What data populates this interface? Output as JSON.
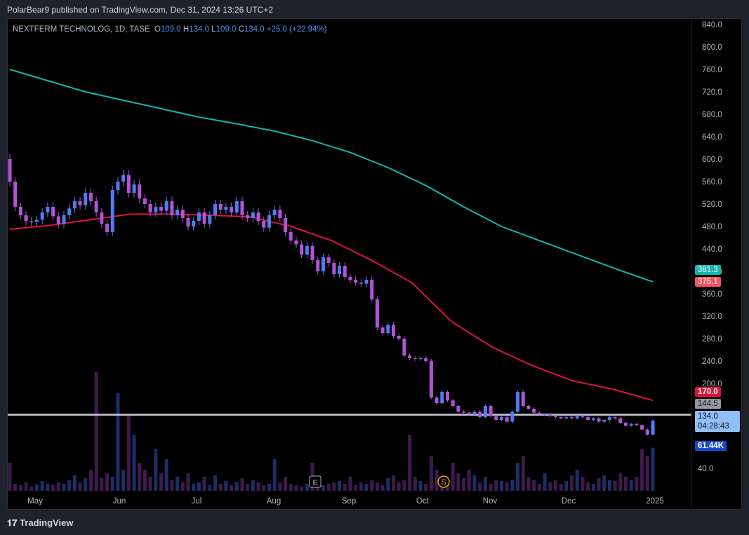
{
  "published": "PolarBear9 published on TradingView.com, Dec 31, 2024 13:26 UTC+2",
  "legend": {
    "symbol": "NEXTFERM TECHNOLOG, 1D, TASE",
    "o_label": "O",
    "o": "109.0",
    "h_label": "H",
    "h": "134.0",
    "l_label": "L",
    "l": "109.0",
    "c_label": "C",
    "c": "134.0",
    "change": "+25.0 (+22.94%)"
  },
  "brand": "TradingView",
  "colors": {
    "up": "#4f7df0",
    "down": "#b452d8",
    "ma_long": "#12b5b0",
    "ma_short": "#e0103a",
    "hline": "#b2b5be"
  },
  "chart_data": {
    "type": "candlestick",
    "x_ticks": [
      "May",
      "Jun",
      "Jul",
      "Aug",
      "Sep",
      "Oct",
      "Nov",
      "Dec",
      "2025"
    ],
    "y_ticks": [
      "840.0",
      "800.0",
      "760.0",
      "720.0",
      "680.0",
      "640.0",
      "600.0",
      "560.0",
      "520.0",
      "480.0",
      "440.0",
      "400.0",
      "360.0",
      "320.0",
      "280.0",
      "240.0",
      "200.0"
    ],
    "ylim": [
      130,
      840
    ],
    "first_open": 600,
    "closes": [
      560,
      515,
      500,
      490,
      488,
      492,
      505,
      515,
      498,
      485,
      500,
      512,
      525,
      518,
      540,
      525,
      505,
      485,
      470,
      545,
      560,
      572,
      540,
      555,
      530,
      520,
      505,
      515,
      508,
      525,
      500,
      510,
      495,
      480,
      490,
      505,
      485,
      500,
      520,
      510,
      515,
      505,
      525,
      500,
      495,
      505,
      490,
      478,
      500,
      510,
      495,
      470,
      455,
      448,
      430,
      445,
      420,
      400,
      425,
      415,
      395,
      410,
      390,
      385,
      380,
      378,
      385,
      350,
      300,
      290,
      305,
      285,
      280,
      250,
      245,
      244,
      245,
      240,
      175,
      165,
      185,
      170,
      160,
      150,
      148,
      145,
      150,
      140,
      160,
      142,
      135,
      140,
      132,
      150,
      185,
      160,
      155,
      148,
      145,
      145,
      142,
      140,
      138,
      140,
      138,
      142,
      140,
      135,
      138,
      132,
      135,
      140,
      138,
      130,
      125,
      128,
      126,
      118,
      109,
      134
    ],
    "volume_k": [
      40,
      10,
      8,
      12,
      6,
      9,
      14,
      10,
      8,
      12,
      10,
      15,
      22,
      12,
      18,
      30,
      170,
      18,
      25,
      20,
      140,
      30,
      110,
      80,
      40,
      30,
      20,
      60,
      25,
      45,
      15,
      20,
      12,
      25,
      10,
      12,
      20,
      8,
      22,
      10,
      14,
      8,
      12,
      18,
      10,
      15,
      12,
      8,
      10,
      45,
      12,
      20,
      10,
      8,
      6,
      10,
      40,
      15,
      8,
      10,
      12,
      14,
      10,
      20,
      8,
      12,
      10,
      15,
      12,
      8,
      18,
      22,
      12,
      15,
      80,
      20,
      14,
      10,
      50,
      30,
      15,
      10,
      40,
      25,
      18,
      30,
      22,
      12,
      20,
      10,
      15,
      14,
      12,
      16,
      40,
      50,
      20,
      15,
      10,
      25,
      12,
      15,
      10,
      14,
      22,
      30,
      20,
      12,
      10,
      18,
      22,
      15,
      14,
      25,
      20,
      15,
      20,
      60,
      50,
      61.44
    ],
    "ma_long": [
      760,
      740,
      720,
      705,
      690,
      675,
      663,
      650,
      633,
      612,
      585,
      553,
      515,
      480,
      455,
      430,
      405,
      381.3
    ],
    "ma_short": [
      475,
      482,
      492,
      502,
      502,
      500,
      497,
      480,
      455,
      420,
      380,
      310,
      265,
      232,
      205,
      190,
      170
    ]
  },
  "labels": {
    "ma_long": "381.3",
    "ma_short_prev": "375.1",
    "ma_short": "170.0",
    "hline": "144.5",
    "last": "134.0",
    "countdown": "04:28:43",
    "volume": "61.44K",
    "vol_tick": "40.0"
  },
  "markers": {
    "earnings": "E",
    "split": "S"
  }
}
